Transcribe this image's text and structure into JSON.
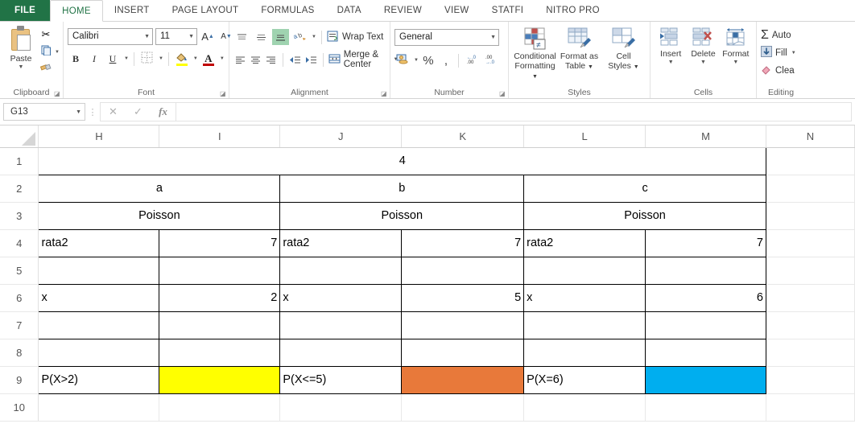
{
  "tabs": [
    {
      "label": "FILE",
      "type": "file"
    },
    {
      "label": "HOME",
      "type": "active"
    },
    {
      "label": "INSERT",
      "type": "normal"
    },
    {
      "label": "PAGE LAYOUT",
      "type": "normal"
    },
    {
      "label": "FORMULAS",
      "type": "normal"
    },
    {
      "label": "DATA",
      "type": "normal"
    },
    {
      "label": "REVIEW",
      "type": "normal"
    },
    {
      "label": "VIEW",
      "type": "normal"
    },
    {
      "label": "STATFI",
      "type": "normal"
    },
    {
      "label": "NITRO PRO",
      "type": "normal"
    }
  ],
  "ribbon": {
    "clipboard": {
      "group_label": "Clipboard",
      "paste_label": "Paste",
      "cut_icon": "scissors-icon",
      "copy_icon": "copy-icon",
      "format_painter_icon": "format-painter-icon"
    },
    "font": {
      "group_label": "Font",
      "font_name": "Calibri",
      "font_size": "11",
      "grow_font": "A",
      "shrink_font": "A",
      "bold": "B",
      "italic": "I",
      "underline": "U",
      "borders_icon": "borders-icon",
      "fill_color_icon": "fill-color-icon",
      "font_color_icon": "font-color-icon"
    },
    "alignment": {
      "group_label": "Alignment",
      "wrap_text": "Wrap Text",
      "merge_center": "Merge & Center",
      "orientation_icon": "orientation-icon",
      "decrease_indent_icon": "decrease-indent-icon",
      "increase_indent_icon": "increase-indent-icon"
    },
    "number": {
      "group_label": "Number",
      "format": "General",
      "accounting_icon": "accounting-format-icon",
      "percent": "%",
      "comma": ",",
      "increase_decimal": "increase-decimal-icon",
      "decrease_decimal": "decrease-decimal-icon"
    },
    "styles": {
      "group_label": "Styles",
      "items": [
        {
          "line1": "Conditional",
          "line2": "Formatting"
        },
        {
          "line1": "Format as",
          "line2": "Table"
        },
        {
          "line1": "Cell",
          "line2": "Styles"
        }
      ]
    },
    "cells": {
      "group_label": "Cells",
      "items": [
        {
          "label": "Insert"
        },
        {
          "label": "Delete"
        },
        {
          "label": "Format"
        }
      ]
    },
    "editing": {
      "group_label": "Editing",
      "items": [
        {
          "label": "Auto",
          "icon": "autosum-icon"
        },
        {
          "label": "Fill",
          "icon": "fill-down-icon"
        },
        {
          "label": "Clea",
          "icon": "clear-eraser-icon"
        }
      ]
    }
  },
  "formula_bar": {
    "name_box": "G13",
    "cancel_icon": "cancel-x-icon",
    "enter_icon": "confirm-check-icon",
    "function_icon": "insert-function-icon",
    "formula_value": ""
  },
  "grid": {
    "columns": [
      "H",
      "I",
      "J",
      "K",
      "L",
      "M",
      "N"
    ],
    "rows": [
      "1",
      "2",
      "3",
      "4",
      "5",
      "6",
      "7",
      "8",
      "9",
      "10"
    ],
    "colors": {
      "yellow": "#FFFF00",
      "orange": "#E8793A",
      "blue": "#00AEEF"
    },
    "cells": {
      "r1_merged": "4",
      "r2_a": "a",
      "r2_b": "b",
      "r2_c": "c",
      "r3_a": "Poisson",
      "r3_b": "Poisson",
      "r3_c": "Poisson",
      "r4_H": "rata2",
      "r4_I": "7",
      "r4_J": "rata2",
      "r4_K": "7",
      "r4_L": "rata2",
      "r4_M": "7",
      "r6_H": "x",
      "r6_I": "2",
      "r6_J": "x",
      "r6_K": "5",
      "r6_L": "x",
      "r6_M": "6",
      "r9_H": "P(X>2)",
      "r9_I": "",
      "r9_J": "P(X<=5)",
      "r9_K": "",
      "r9_L": "P(X=6)",
      "r9_M": ""
    }
  }
}
